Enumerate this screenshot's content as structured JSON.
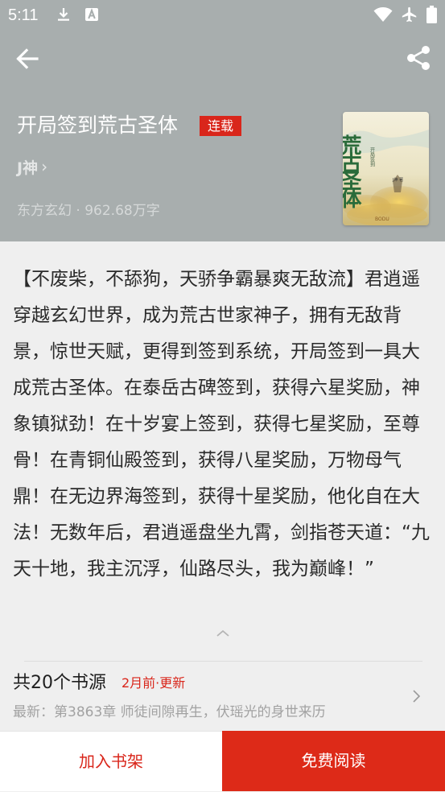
{
  "status_bar": {
    "time": "5:11",
    "left_icons": [
      "download-icon",
      "a-notification-icon"
    ],
    "right_icons": [
      "wifi-icon",
      "airplane-mode-icon",
      "battery-icon"
    ]
  },
  "nav": {
    "back_icon": "arrow-left-icon",
    "share_icon": "share-icon"
  },
  "book": {
    "title": "开局签到荒古圣体",
    "status_badge": "连载",
    "author": "J神",
    "author_chevron": "›",
    "meta": "东方玄幻 · 962.68万字",
    "cover": {
      "title_text": "荒古圣体",
      "sub_text": "开局签到",
      "author_text": "J神 著",
      "brand_text": "BODU"
    }
  },
  "synopsis": {
    "text": "【不废柴，不舔狗，天骄争霸暴爽无敌流】君逍遥穿越玄幻世界，成为荒古世家神子，拥有无敌背景，惊世天赋，更得到签到系统，开局签到一具大成荒古圣体。在泰岳古碑签到，获得六星奖励，神象镇狱劲！在十岁宴上签到，获得七星奖励，至尊骨！在青铜仙殿签到，获得八星奖励，万物母气鼎！在无边界海签到，获得十星奖励，他化自在大法！无数年后，君逍遥盘坐九霄，剑指苍天道：“九天十地，我主沉浮，仙路尽头，我为巅峰！”",
    "toggle_icon": "chevron-up-icon"
  },
  "sources": {
    "count_label": "共20个书源",
    "updated_label": "2月前·更新",
    "latest_label": "最新：第3863章 师徒间隙再生，伏瑶光的身世来历"
  },
  "actions": {
    "add_to_shelf": "加入书架",
    "read_free": "免费阅读"
  },
  "colors": {
    "header_bg": "#a8aeae",
    "accent_red": "#d9261b",
    "read_button_bg": "#dd2a18",
    "page_bg": "#efefef"
  }
}
